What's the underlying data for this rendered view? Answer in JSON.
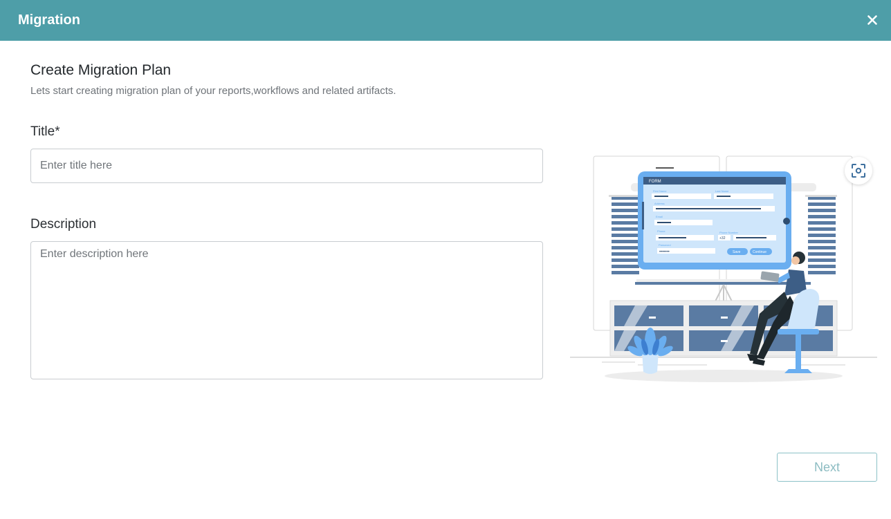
{
  "header": {
    "title": "Migration",
    "close_icon": "close-icon",
    "background_color": "#4e9ea8"
  },
  "plan": {
    "title": "Create Migration Plan",
    "subtitle": "Lets start creating migration plan of your reports,workflows and related artifacts."
  },
  "form": {
    "title_label": "Title*",
    "title_placeholder": "Enter title here",
    "title_value": "",
    "description_label": "Description",
    "description_placeholder": "Enter description here",
    "description_value": ""
  },
  "illustration": {
    "icon": "form-illustration",
    "screen_header": "FORM",
    "field_labels": [
      "First Name",
      "Last Name",
      "Address",
      "Email",
      "Phone",
      "Phone Number",
      "Password"
    ],
    "password_mask": "•••••••",
    "phone_code": "+32",
    "save_label": "Save",
    "continue_label": "Continue"
  },
  "scan_button": {
    "icon": "scan-icon"
  },
  "footer": {
    "next_label": "Next",
    "next_color": "#8cbcc2"
  }
}
